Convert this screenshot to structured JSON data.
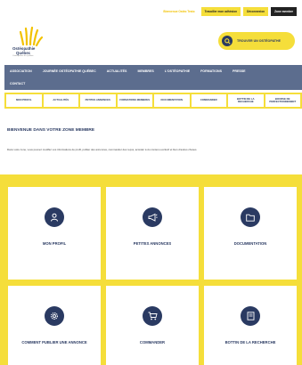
{
  "topbar": {
    "link1": "Bienvenue Ostéo Testo",
    "link2": "Travailler mon adhésion",
    "link3": "Déconnexion",
    "link4": "Zone membre"
  },
  "logo": {
    "line1": "Ostéopathie",
    "line2": "Québec",
    "line3": "Ostéopathes du Québec"
  },
  "find_button": {
    "label": "TROUVER UN OSTÉOPATHE"
  },
  "nav": {
    "items": [
      "ASSOCIATION",
      "JOURNÉE OSTÉOPATHIE QUÉBEC",
      "ACTUALITÉS",
      "MEMBRES",
      "L'OSTÉOPATHIE",
      "FORMATIONS",
      "PRESSE",
      "CONTACT"
    ]
  },
  "subnav": {
    "items": [
      "MON PROFIL",
      "ACTUALITÉS",
      "PETITES ANNONCES",
      "FORMATIONS MEMBRES",
      "DOCUMENTATION",
      "COMMANDER",
      "BOTTIN DE LA RECHERCHE",
      "BOURSE DE PERFECTIONNEMENT"
    ]
  },
  "welcome": {
    "title": "BIENVENUE DANS VOTRE ZONE MEMBRE",
    "text": "Dans votre zone, vous pouvez modifier vos informations de profil, publier des annonces, commander des reçus, accéder à du contenu exclusif et bien d'autres choses."
  },
  "cards": [
    {
      "label": "MON PROFIL",
      "icon": "user-icon"
    },
    {
      "label": "PETITES ANNONCES",
      "icon": "megaphone-icon"
    },
    {
      "label": "DOCUMENTATION",
      "icon": "folder-icon"
    },
    {
      "label": "COMMENT PUBLIER UNE ANNONCE",
      "icon": "gear-icon"
    },
    {
      "label": "COMMANDER",
      "icon": "cart-icon"
    },
    {
      "label": "BOTTIN DE LA RECHERCHE",
      "icon": "book-icon"
    }
  ],
  "colors": {
    "accent_yellow": "#f5de3a",
    "navy": "#2a3a62",
    "nav_bg": "#5c6d8e"
  }
}
